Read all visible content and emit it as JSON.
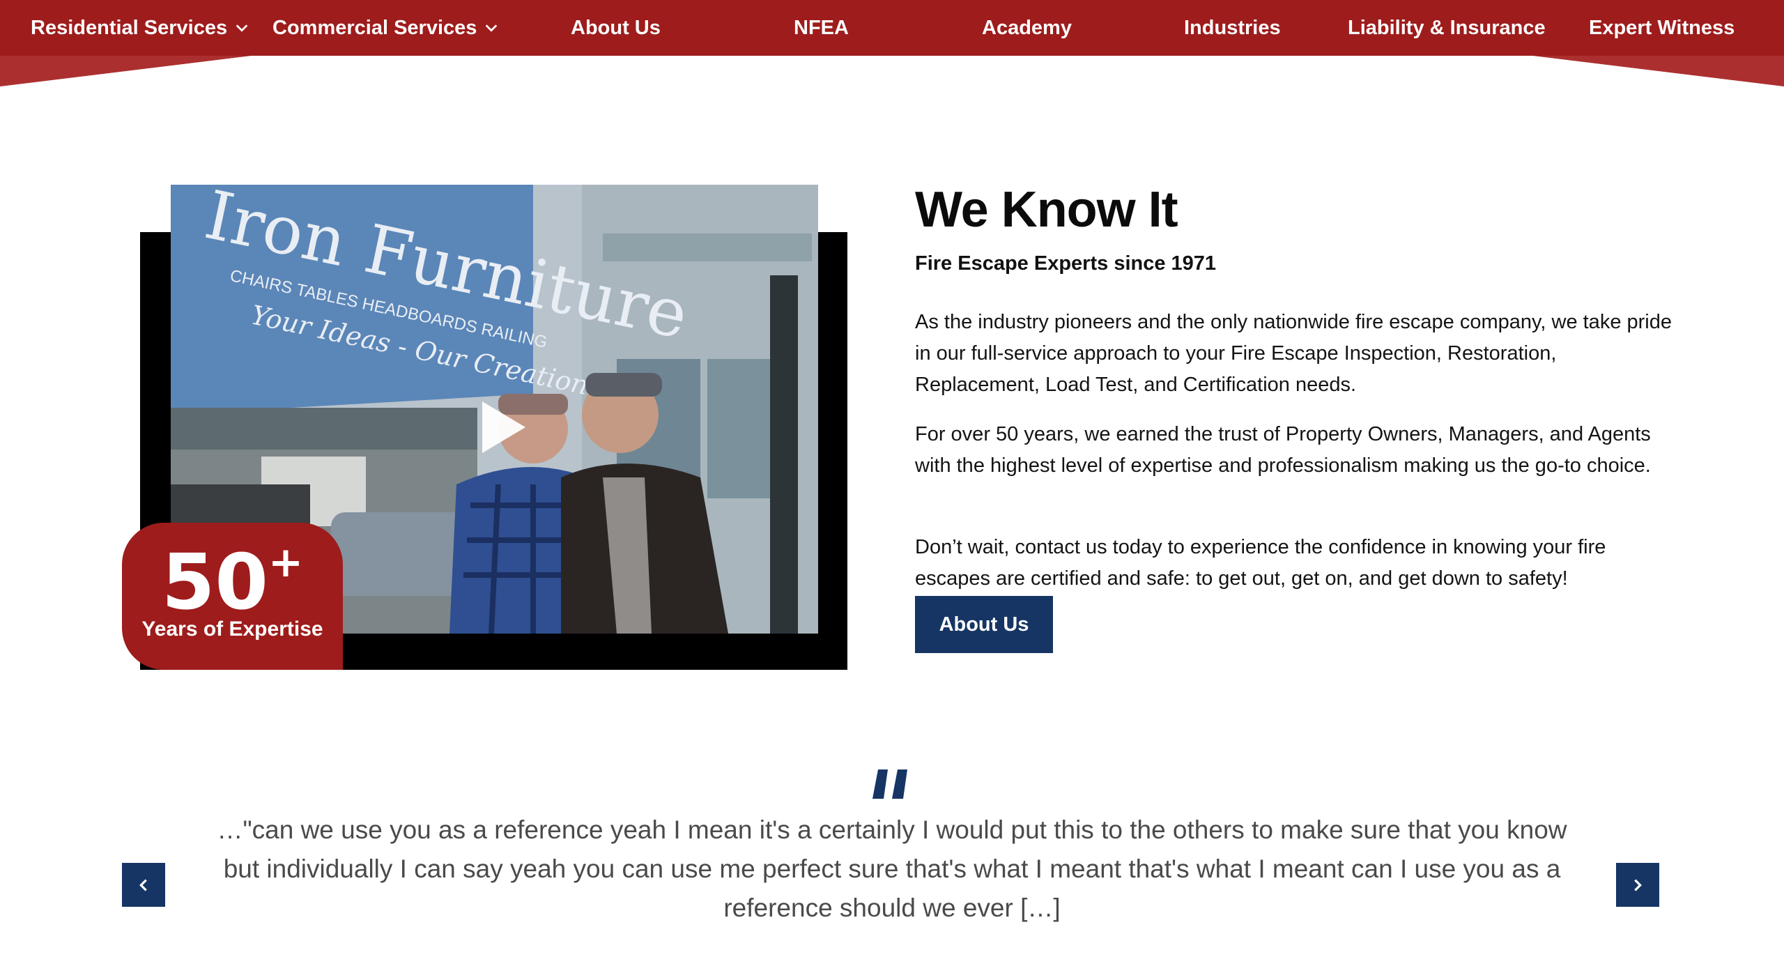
{
  "nav": {
    "items": [
      {
        "label": "Residential Services",
        "dropdown": true
      },
      {
        "label": "Commercial Services",
        "dropdown": true
      },
      {
        "label": "About Us",
        "dropdown": false
      },
      {
        "label": "NFEA",
        "dropdown": false
      },
      {
        "label": "Academy",
        "dropdown": false
      },
      {
        "label": "Industries",
        "dropdown": false
      },
      {
        "label": "Liability & Insurance",
        "dropdown": false
      },
      {
        "label": "Expert Witness",
        "dropdown": false
      }
    ]
  },
  "media": {
    "photo_sign_text": {
      "line1": "Iron Furniture",
      "line2": "CHAIRS  TABLES  HEADBOARDS  RAILING",
      "line3": "Your Ideas - Our Creation"
    },
    "badge": {
      "number": "50",
      "suffix": "+",
      "label": "Years of Expertise"
    }
  },
  "about": {
    "heading": "We Know It",
    "subheading": "Fire Escape Experts since 1971",
    "paragraphs": [
      "As the industry pioneers and the only nationwide fire escape company, we take pride in our full-service approach to your Fire Escape Inspection, Restoration, Replacement, Load Test, and Certification needs.",
      "For over 50 years, we earned the trust of Property Owners, Managers, and Agents with the highest level of expertise and professionalism making us the go-to choice.",
      "Don’t wait, contact us today to experience the confidence in knowing your fire escapes are certified and safe: to get out, get on, and get down to safety!"
    ],
    "button_label": "About Us"
  },
  "testimonial": {
    "quote": "…\"can we use you as a reference  yeah I mean it's a certainly I would put this to the others to make sure that you know but individually I can say yeah you can use me  perfect sure that's what I meant that's what I meant can I use you as a reference should we ever […]"
  },
  "colors": {
    "brand_red": "#9e1c1c",
    "brand_navy": "#163564",
    "text_dark": "#111111",
    "text_gray": "#4a4a4a"
  },
  "icons": {
    "dropdown": "chevron-down-icon",
    "play": "play-icon",
    "quote": "quote-icon",
    "prev": "chevron-left-icon",
    "next": "chevron-right-icon"
  }
}
